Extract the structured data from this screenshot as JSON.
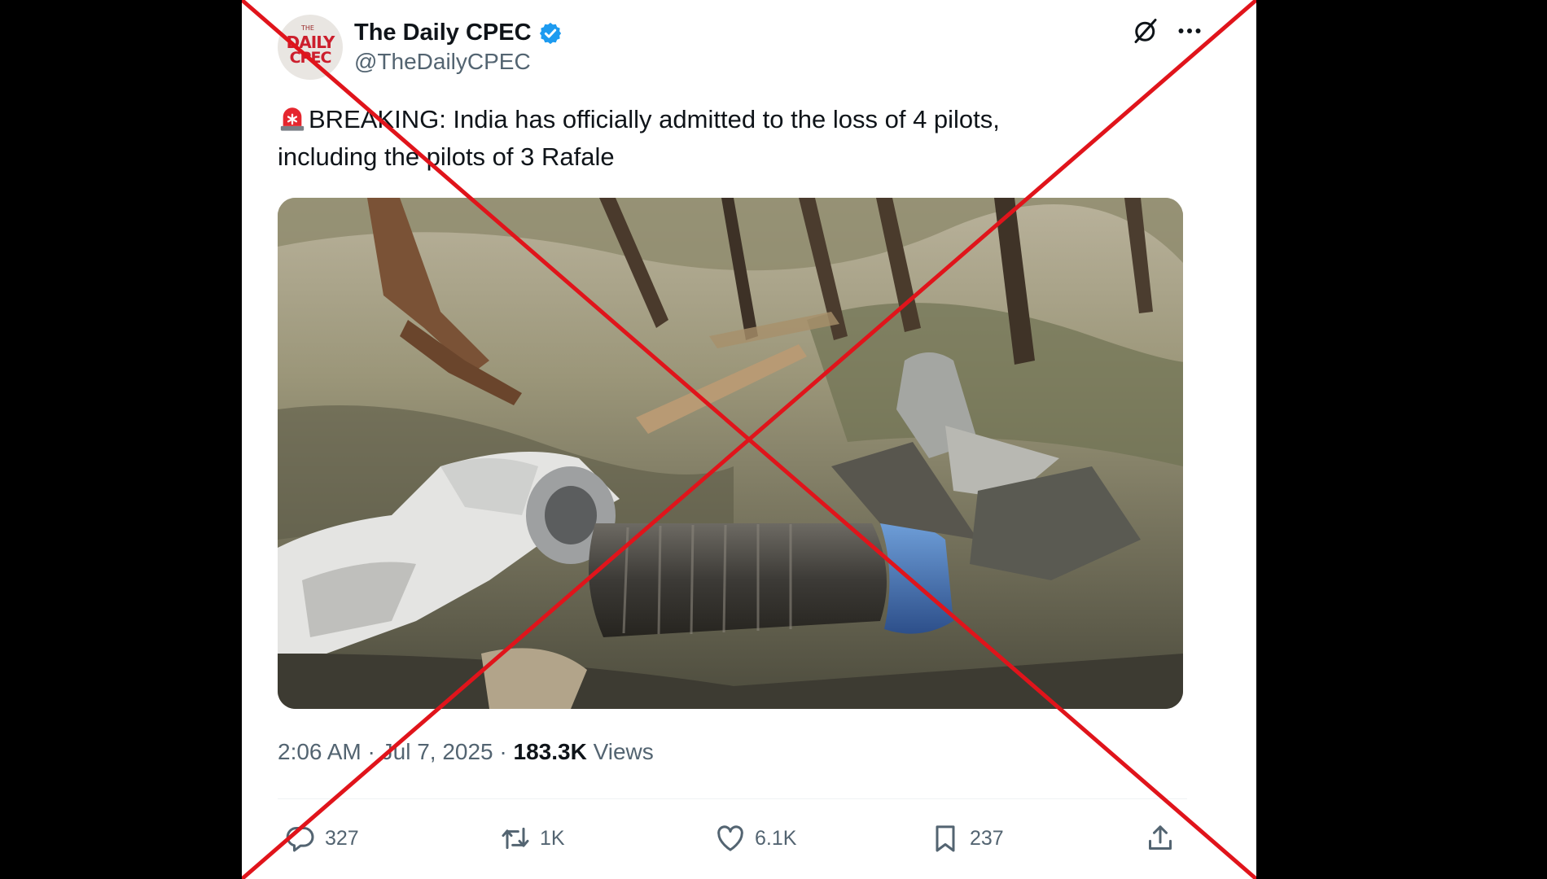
{
  "post": {
    "author_name": "The Daily CPEC",
    "handle": "@TheDailyCPEC",
    "avatar_text_small": "THE",
    "avatar_text_line1": "DAILY",
    "avatar_text_line2": "CPEC",
    "text_line1": "BREAKING: India has officially admitted to the loss of 4 pilots,",
    "text_line2": "including the pilots of 3 Rafale",
    "time": "2:06 AM",
    "date": "Jul 7, 2025",
    "separator": "·",
    "views_count": "183.3K",
    "views_label": "Views"
  },
  "actions": {
    "replies": "327",
    "reposts": "1K",
    "likes": "6.1K",
    "bookmarks": "237"
  },
  "icons": {
    "verified": "verified-badge-icon",
    "grok": "grok-icon",
    "more": "more-icon",
    "siren": "siren-icon",
    "reply": "reply-icon",
    "repost": "repost-icon",
    "like": "like-icon",
    "bookmark": "bookmark-icon",
    "share": "share-icon"
  },
  "colors": {
    "verified": "#1d9bf0",
    "secondary_text": "#536471",
    "primary_text": "#0f1419",
    "cross_mark": "#e0141b",
    "background": "#000000"
  }
}
